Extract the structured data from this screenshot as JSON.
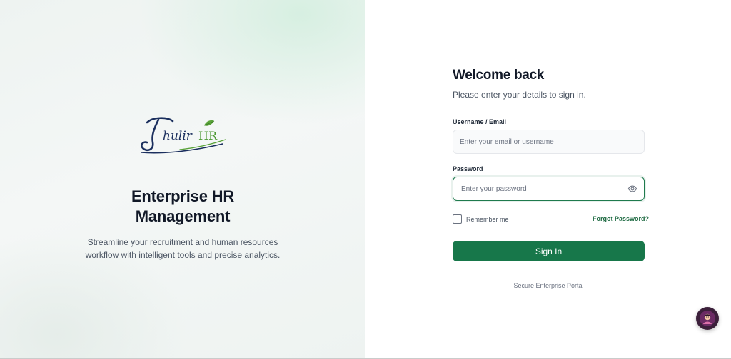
{
  "brand": {
    "logo_text": "Thulir HR",
    "title_line1": "Enterprise HR",
    "title_line2": "Management",
    "desc_line1": "Streamline your recruitment and human resources",
    "desc_line2": "workflow with intelligent tools and precise analytics."
  },
  "login": {
    "heading": "Welcome back",
    "subtitle": "Please enter your details to sign in.",
    "username_label": "Username / Email",
    "username_placeholder": "Enter your email or username",
    "username_value": "",
    "password_label": "Password",
    "password_placeholder": "Enter your password",
    "password_value": "",
    "remember_label": "Remember me",
    "remember_checked": false,
    "forgot_label": "Forgot Password?",
    "signin_label": "Sign In",
    "footer": "Secure Enterprise Portal"
  },
  "icons": {
    "password_toggle": "eye-icon",
    "chat": "chatbot-avatar-icon"
  },
  "colors": {
    "primary": "#17774a",
    "link": "#1f6b43",
    "heading": "#111827",
    "muted": "#4b5563"
  }
}
